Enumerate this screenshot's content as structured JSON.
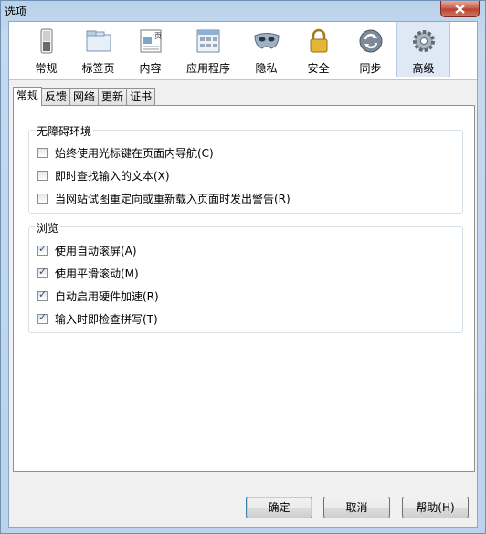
{
  "window": {
    "title": "选项"
  },
  "toolbar": {
    "items": [
      {
        "label": "常规",
        "icon": "switch-icon"
      },
      {
        "label": "标签页",
        "icon": "tabs-icon"
      },
      {
        "label": "内容",
        "icon": "page-icon"
      },
      {
        "label": "应用程序",
        "icon": "application-icon"
      },
      {
        "label": "隐私",
        "icon": "mask-icon"
      },
      {
        "label": "安全",
        "icon": "lock-icon"
      },
      {
        "label": "同步",
        "icon": "sync-icon"
      },
      {
        "label": "高级",
        "icon": "gear-icon"
      }
    ],
    "selected": "高级"
  },
  "tabs": [
    "常规",
    "反馈",
    "网络",
    "更新",
    "证书"
  ],
  "active_tab": "常规",
  "groups": {
    "accessibility": {
      "title": "无障碍环境",
      "options": [
        {
          "label": "始终使用光标键在页面内导航(C)",
          "checked": false
        },
        {
          "label": "即时查找输入的文本(X)",
          "checked": false
        },
        {
          "label": "当网站试图重定向或重新载入页面时发出警告(R)",
          "checked": false
        }
      ]
    },
    "browsing": {
      "title": "浏览",
      "options": [
        {
          "label": "使用自动滚屏(A)",
          "checked": true
        },
        {
          "label": "使用平滑滚动(M)",
          "checked": true
        },
        {
          "label": "自动启用硬件加速(R)",
          "checked": true
        },
        {
          "label": "输入时即检查拼写(T)",
          "checked": true
        }
      ]
    }
  },
  "buttons": {
    "ok": "确定",
    "cancel": "取消",
    "help": "帮助(H)"
  }
}
